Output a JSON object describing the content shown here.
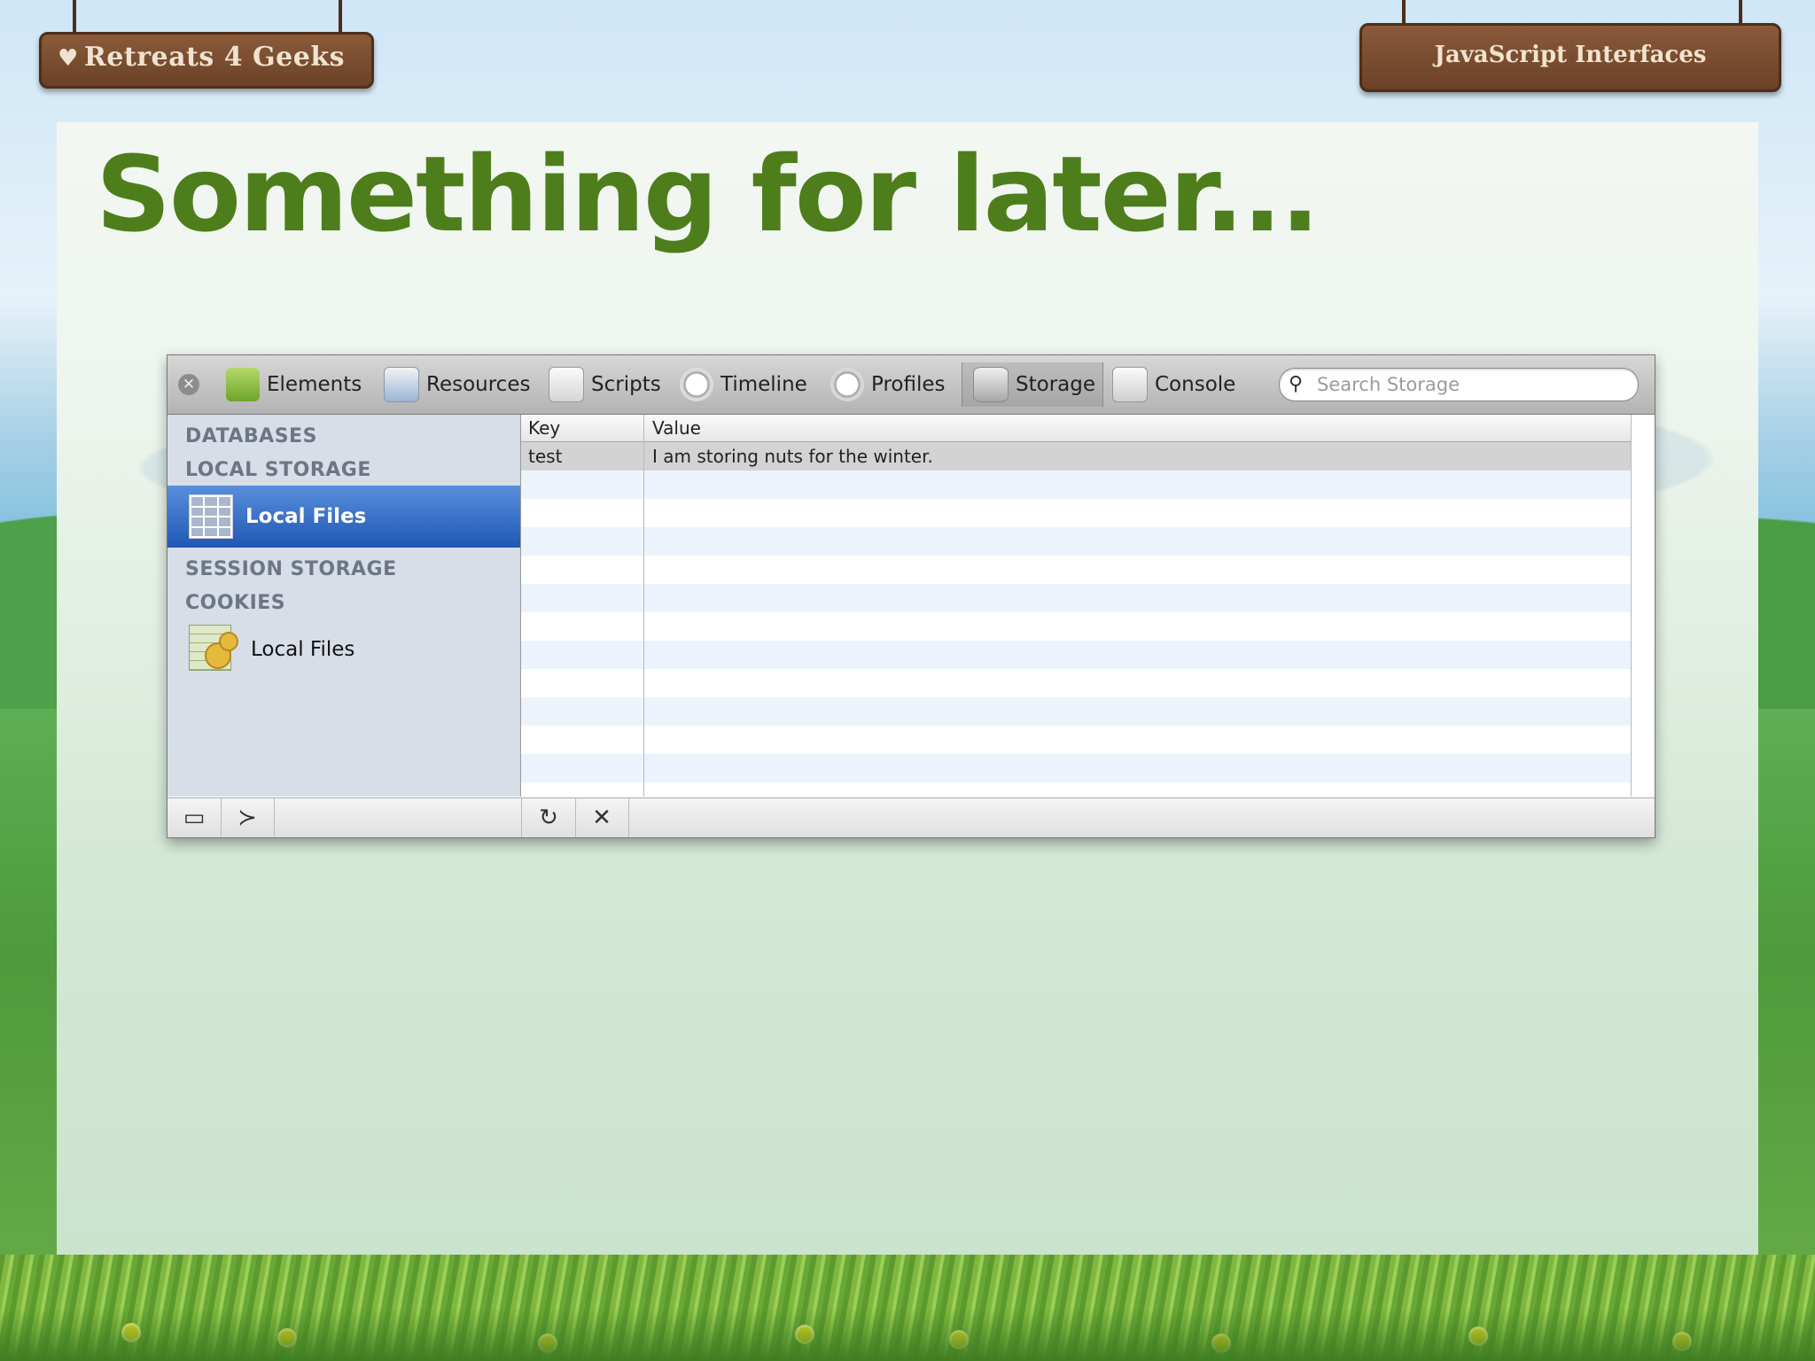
{
  "header": {
    "logo_text": "Retreats 4 Geeks",
    "section_title": "JavaScript Interfaces"
  },
  "slide": {
    "title": "Something for later..."
  },
  "inspector": {
    "tabs": [
      {
        "label": "Elements",
        "icon": "elements-icon"
      },
      {
        "label": "Resources",
        "icon": "resources-icon"
      },
      {
        "label": "Scripts",
        "icon": "scripts-icon"
      },
      {
        "label": "Timeline",
        "icon": "timeline-icon"
      },
      {
        "label": "Profiles",
        "icon": "profiles-icon"
      },
      {
        "label": "Storage",
        "icon": "storage-icon",
        "active": true
      },
      {
        "label": "Console",
        "icon": "console-icon"
      }
    ],
    "search": {
      "placeholder": "Search Storage",
      "value": ""
    },
    "sidebar": {
      "databases": "DATABASES",
      "local_storage": "LOCAL STORAGE",
      "local_storage_item": "Local Files",
      "session_storage": "SESSION STORAGE",
      "cookies": "COOKIES",
      "cookies_item": "Local Files"
    },
    "table": {
      "columns": [
        "Key",
        "Value"
      ],
      "rows": [
        {
          "key": "test",
          "value": "I am storing nuts for the winter."
        }
      ]
    },
    "status_icons": [
      "dock-icon",
      "console-toggle-icon",
      "refresh-icon",
      "delete-icon"
    ]
  }
}
